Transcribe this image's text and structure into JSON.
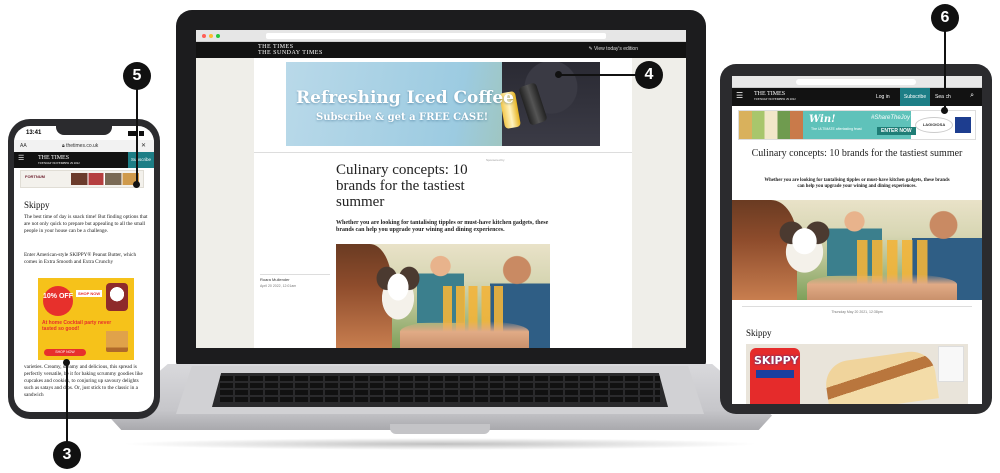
{
  "callouts": {
    "phone_bottom": "3",
    "laptop": "4",
    "phone_top": "5",
    "tablet": "6"
  },
  "laptop": {
    "logo_line1": "THE TIMES",
    "logo_line2": "THE SUNDAY TIMES",
    "edition_link": "View today's edition",
    "ad_headline": "Refreshing Iced Coffee",
    "ad_subline": "Subscribe & get a FREE CASE!",
    "sponsor": "Sponsored by",
    "article_title": "Culinary concepts: 10 brands for the tastiest summer",
    "standfirst": "Whether you are looking for tantalising tipples or must-have kitchen gadgets, these brands can help you upgrade your wining and dining experiences.",
    "author": "Roara Mullender",
    "date": "April 20 2022, 12:01am"
  },
  "phone": {
    "time": "13:41",
    "url_aa": "AA",
    "url": "thetimes.co.uk",
    "close": "✕",
    "menu": "☰",
    "logo_line1": "THE TIMES",
    "logo_line2": "TUESDAY NOVEMBER 29 2022",
    "subscribe": "Subscribe",
    "banner_brand": "FORTNUM",
    "section_heading": "Skippy",
    "para1": "The best time of day is snack time! But finding options that are not only quick to prepare but appealing to all the small people in your house can be a challenge.",
    "para2": "Enter American-style SKIPPY® Peanut Butter, which comes in Extra Smooth and Extra Crunchy",
    "para3": "varieties. Creamy, dreamy and delicious, this spread is perfectly versatile, be it for baking scrummy goodies like cupcakes and cookies, to conjuring up savoury delights such as satays and dips. Or, just stick to the classic in a sandwich",
    "ad_offer": "10% OFF",
    "ad_shop": "SHOP NOW",
    "ad_slogan": "At home Cocktail party never tasted so good!",
    "ad_cta": "SHOP NOW"
  },
  "tablet": {
    "menu": "☰",
    "logo": "THE TIMES",
    "date_line": "TUESDAY NOVEMBER 29 2022",
    "login": "Log in",
    "subscribe": "Subscribe",
    "search": "Search",
    "ad_win": "Win!",
    "ad_small": "The ULTIMATE aftertasting feast",
    "ad_hashtag": "#ShareTheJoy",
    "ad_enter": "ENTER NOW",
    "ad_brand": "LAGIOIOSA",
    "article_title": "Culinary concepts: 10 brands for the tastiest summer",
    "standfirst": "Whether you are looking for tantalising tipples or must-have kitchen gadgets, these brands can help you upgrade your wining and dining experiences.",
    "date": "Thursday May 20 2021, 12:38pm",
    "section_heading": "Skippy",
    "jar_label": "SKIPPY"
  }
}
